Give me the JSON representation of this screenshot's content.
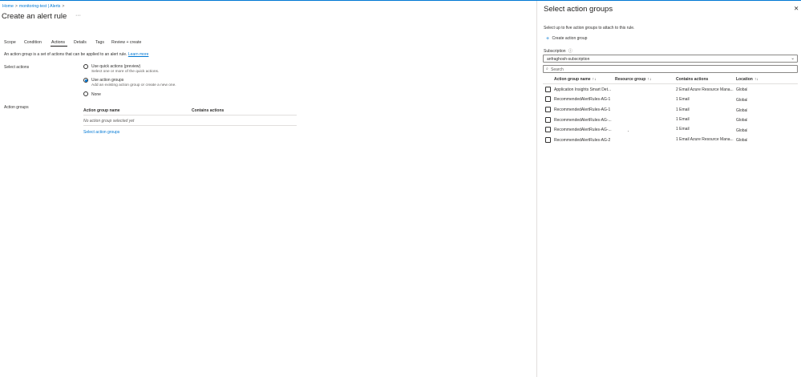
{
  "breadcrumb": {
    "home": "Home",
    "resource": "monitoring-test | Alerts",
    "separator": ">"
  },
  "page": {
    "title": "Create an alert rule",
    "more": "···"
  },
  "tabs": [
    "Scope",
    "Condition",
    "Actions",
    "Details",
    "Tags",
    "Review + create"
  ],
  "active_tab": "Actions",
  "actions_section": {
    "description": "An action group is a set of actions that can be applied to an alert rule.",
    "learn_more": "Learn more",
    "select_actions_label": "Select actions",
    "options": [
      {
        "label": "Use quick actions (preview)",
        "sub": "Select one or more of the quick actions.",
        "checked": false
      },
      {
        "label": "Use action groups",
        "sub": "Add an existing action group or create a new one.",
        "checked": true
      },
      {
        "label": "None",
        "sub": "",
        "checked": false
      }
    ],
    "action_groups_label": "Action groups",
    "table_headers": [
      "Action group name",
      "Contains actions"
    ],
    "empty_message": "No action group selected yet",
    "select_link": "Select action groups"
  },
  "panel": {
    "title": "Select action groups",
    "close": "✕",
    "description": "Select up to five action groups to attach to this rule.",
    "create_button": "Create action group",
    "subscription_label": "Subscription",
    "subscription_value": "anfraghosh-subscription",
    "search_placeholder": "Search",
    "columns": [
      "Action group name",
      "Resource group",
      "Contains actions",
      "Location"
    ],
    "rows": [
      {
        "name": "Application Insights Smart Det...",
        "resource_group": "",
        "actions": "2 Email Azure Resource Mana...",
        "location": "Global"
      },
      {
        "name": "RecommendedAlertRules-AG-1",
        "resource_group": "",
        "actions": "1 Email",
        "location": "Global"
      },
      {
        "name": "RecommendedAlertRules-AG-1",
        "resource_group": "",
        "actions": "1 Email",
        "location": "Global"
      },
      {
        "name": "RecommendedAlertRules-AG-...",
        "resource_group": "",
        "actions": "1 Email",
        "location": "Global"
      },
      {
        "name": "RecommendedAlertRules-AG-...",
        "resource_group": "",
        "actions": "1 Email",
        "location": "Global"
      },
      {
        "name": "RecommendedAlertRules-AG-2",
        "resource_group": "",
        "actions": "1 Email Azure Resource Mana...",
        "location": "Global"
      }
    ]
  },
  "icons": {
    "info": "ⓘ",
    "plus": "+",
    "search": "⌕",
    "chevron_down": "⌄",
    "sort": "↑↓"
  },
  "colors": {
    "accent": "#0078d4",
    "text": "#323130",
    "border": "#e1dfdd"
  }
}
